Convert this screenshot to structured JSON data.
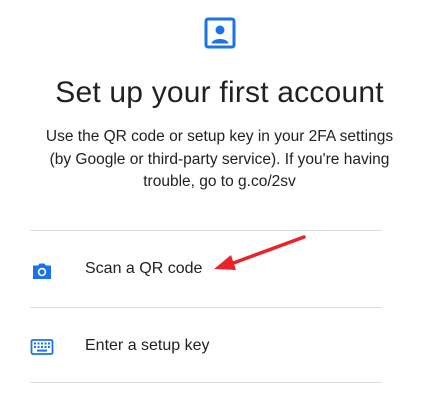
{
  "header": {
    "icon": "account-box-icon"
  },
  "title": "Set up your first account",
  "description": "Use the QR code or setup key in your 2FA settings (by Google or third-party service). If you're having trouble, go to g.co/2sv",
  "options": [
    {
      "label": "Scan a QR code",
      "icon": "camera-icon"
    },
    {
      "label": "Enter a setup key",
      "icon": "keyboard-icon"
    }
  ],
  "colors": {
    "accent": "#1a73e8",
    "text": "#202124",
    "divider": "#dadce0",
    "annotation": "#e8232b"
  }
}
